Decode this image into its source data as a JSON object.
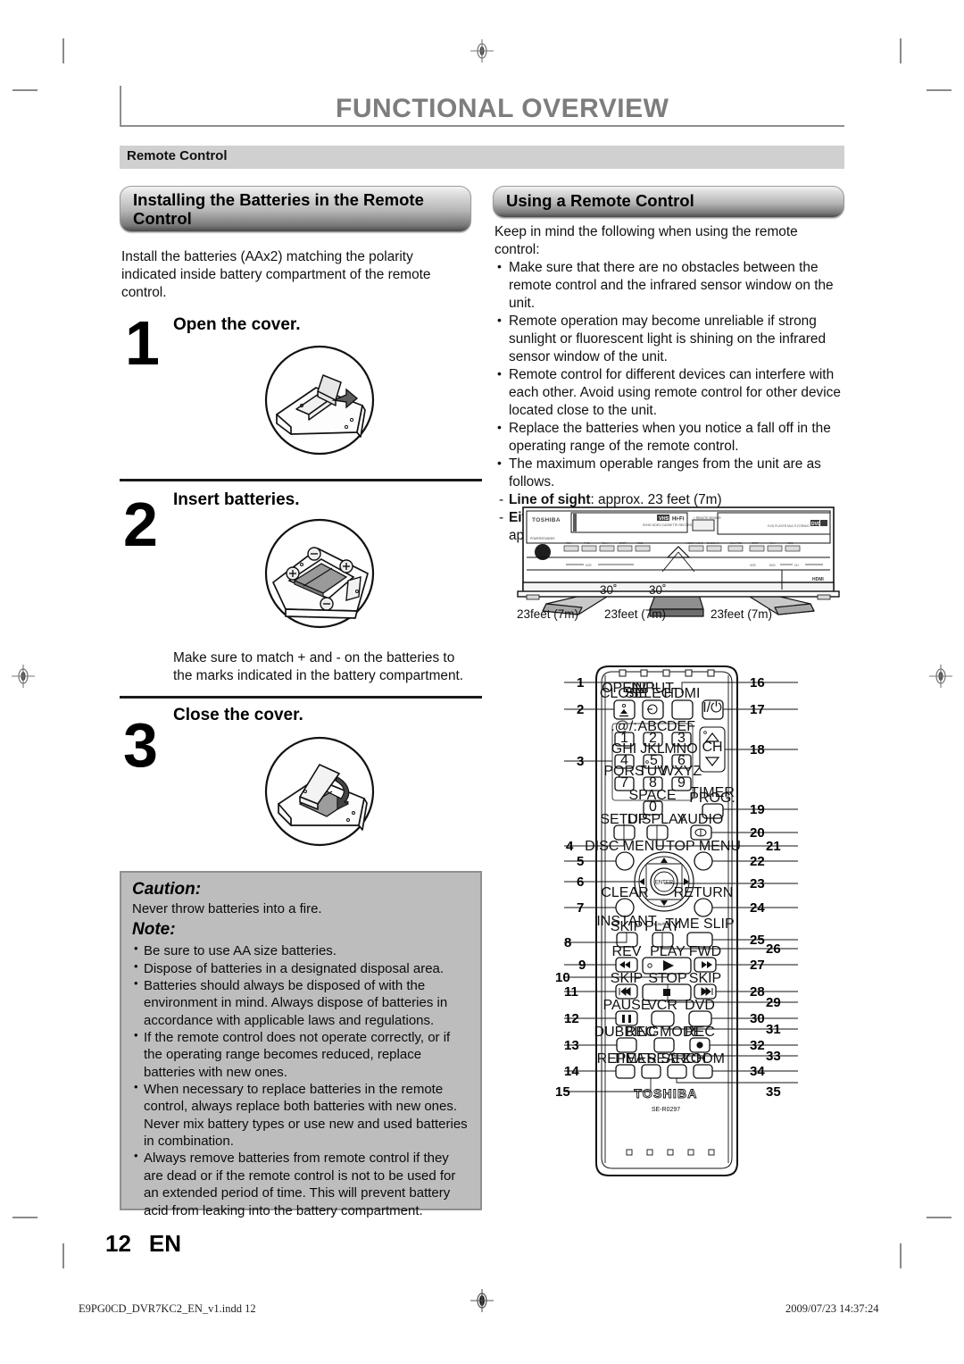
{
  "header": {
    "title": "FUNCTIONAL OVERVIEW",
    "section": "Remote Control"
  },
  "left_column": {
    "heading": "Installing the Batteries in the Remote Control",
    "intro": "Install the batteries (AAx2) matching the polarity indicated inside battery compartment of the remote control.",
    "steps": [
      {
        "number": "1",
        "title": "Open the cover.",
        "note": ""
      },
      {
        "number": "2",
        "title": "Insert batteries.",
        "note": "Make sure to match + and - on the batteries to the marks indicated in the battery compartment."
      },
      {
        "number": "3",
        "title": "Close the cover.",
        "note": ""
      }
    ],
    "notebox": {
      "caution_label": "Caution:",
      "caution_text": "Never throw batteries into a fire.",
      "note_label": "Note:",
      "note_items": [
        "Be sure to use AA size batteries.",
        "Dispose of batteries in a designated disposal area.",
        "Batteries should always be disposed of with the environment in mind. Always dispose of batteries in accordance with applicable laws and regulations.",
        "If the remote control does not operate correctly, or if the operating range becomes reduced, replace batteries with new ones.",
        "When necessary to replace batteries in the remote control, always replace both batteries with new ones. Never mix battery types or use new and used batteries in combination.",
        "Always remove batteries from remote control if they are dead or if the remote control is not to be used for an extended period of time. This will prevent battery acid from leaking into the battery compartment."
      ]
    }
  },
  "right_column": {
    "heading": "Using a Remote Control",
    "intro": "Keep in mind the following when using the remote control:",
    "bullets": [
      "Make sure that there are no obstacles between the remote control and the infrared sensor window on the unit.",
      "Remote operation may become unreliable if strong sunlight or fluorescent light is shining on the infrared sensor window of the unit.",
      "Remote control for different devices can interfere with each other. Avoid using remote control for other device located close to the unit.",
      "Replace the batteries when you notice a fall off in the operating range of the remote control.",
      "The maximum operable ranges from the unit are as follows."
    ],
    "ranges": [
      {
        "label": "Line of sight",
        "sep": ": ",
        "value": "approx. 23 feet (7m)"
      },
      {
        "label": "Either side of the center:",
        "sep": "",
        "value": "approx. 23 feet (7m) within 30°"
      }
    ],
    "unit_diagram": {
      "brand": "TOSHIBA",
      "badges": [
        "VHS",
        "Hi-Fi",
        "DVD"
      ],
      "vhs_sub": "SVHS VIDEO CASSETTE RECORDER/DVD",
      "hdmi_label": "HDMI",
      "angles": [
        "30˚",
        "30˚"
      ],
      "distances": [
        "23feet (7m)",
        "23feet (7m)",
        "23feet (7m)"
      ]
    }
  },
  "remote": {
    "brand": "TOSHIBA",
    "model": "SE-R0297",
    "buttons": {
      "open_close": "OPEN/\nCLOSE",
      "input_select": "INPUT\nSELECT",
      "hdmi": "HDMI",
      "power": "I/⏻",
      "ch": "CH",
      "keypad_letters": [
        ".@/:",
        "ABC",
        "DEF",
        "GHI",
        "JKL",
        "MNO",
        "PQRS",
        "TUV",
        "WXYZ"
      ],
      "keypad_digits": [
        "1",
        "2",
        "3",
        "4",
        "5",
        "6",
        "7",
        "8",
        "9"
      ],
      "space": "SPACE",
      "zero": "0",
      "setup": "SETUP",
      "display": "DISPLAY",
      "audio": "AUDIO",
      "timer_prog": "TIMER\nPROG.",
      "disc_menu": "DISC MENU",
      "top_menu": "TOP MENU",
      "enter": "ENTER",
      "clear": "CLEAR",
      "return": "RETURN",
      "instant_skip": "INSTANT\nSKIP",
      "play_speed": "1.3x/0.8x\nPLAY",
      "time_slip": "TIME SLIP",
      "rev": "REV",
      "play": "PLAY",
      "fwd": "FWD",
      "skip_back": "SKIP",
      "stop": "STOP",
      "skip_fwd": "SKIP",
      "pause": "PAUSE",
      "vcr": "VCR",
      "dvd": "DVD",
      "dubbing": "DUBBING",
      "rec_mode": "REC MODE",
      "rec": "REC",
      "repeat": "REPEAT",
      "timer_set": "TIMER SET",
      "search": "SEARCH",
      "zoom": "ZOOM"
    },
    "callouts_left": [
      "1",
      "2",
      "3",
      "4",
      "5",
      "6",
      "7",
      "8",
      "10",
      "9",
      "11",
      "12",
      "13",
      "14",
      "15"
    ],
    "callouts_right": [
      "16",
      "17",
      "18",
      "19",
      "20",
      "21",
      "22",
      "23",
      "24",
      "25",
      "26",
      "27",
      "28",
      "29",
      "30",
      "31",
      "32",
      "33",
      "34",
      "35"
    ]
  },
  "footer": {
    "page_number": "12",
    "language": "EN",
    "file_name": "E9PG0CD_DVR7KC2_EN_v1.indd   12",
    "timestamp": "2009/07/23   14:37:24"
  }
}
